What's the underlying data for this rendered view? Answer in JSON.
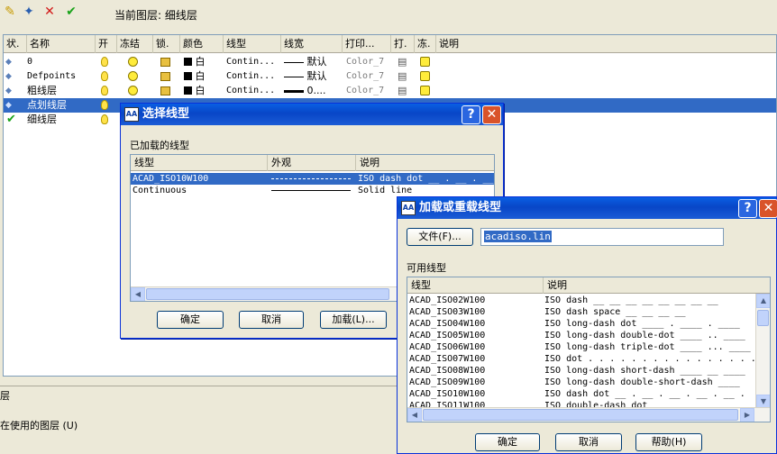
{
  "toolbar": {
    "current_layer_label": "当前图层: 细线层"
  },
  "layer_table": {
    "columns": [
      "状.",
      "名称",
      "开",
      "冻结",
      "锁.",
      "颜色",
      "线型",
      "线宽",
      "打印...",
      "打.",
      "冻.",
      "说明"
    ],
    "rows": [
      {
        "name": "0",
        "color": "白",
        "linetype": "Contin...",
        "lineweight": "默认",
        "plot_style": "Color_7",
        "current": false,
        "selected": false
      },
      {
        "name": "Defpoints",
        "color": "白",
        "linetype": "Contin...",
        "lineweight": "默认",
        "plot_style": "Color_7",
        "current": false,
        "selected": false
      },
      {
        "name": "粗线层",
        "color": "白",
        "linetype": "Contin...",
        "lineweight": "0....",
        "plot_style": "Color_7",
        "current": false,
        "selected": false
      },
      {
        "name": "点划线层",
        "color": "",
        "linetype": "",
        "lineweight": "",
        "plot_style": "",
        "current": false,
        "selected": true
      },
      {
        "name": "细线层",
        "color": "",
        "linetype": "",
        "lineweight": "",
        "plot_style": "",
        "current": true,
        "selected": false
      }
    ]
  },
  "bottom": {
    "fragment1": "层",
    "fragment2": "在使用的图层 (U)"
  },
  "select_dialog": {
    "title": "选择线型",
    "loaded_label": "已加载的线型",
    "columns": [
      "线型",
      "外观",
      "说明"
    ],
    "rows": [
      {
        "name": "ACAD_ISO10W100",
        "desc": "ISO dash dot __ . __ . __",
        "selected": true
      },
      {
        "name": "Continuous",
        "desc": "Solid line",
        "selected": false
      }
    ],
    "ok": "确定",
    "cancel": "取消",
    "load": "加载(L)..."
  },
  "load_dialog": {
    "title": "加载或重载线型",
    "file_button": "文件(F)...",
    "file_value": "acadiso.lin",
    "available_label": "可用线型",
    "columns": [
      "线型",
      "说明"
    ],
    "rows": [
      {
        "name": "ACAD_ISO02W100",
        "desc": "ISO dash __ __ __ __ __ __ __ __"
      },
      {
        "name": "ACAD_ISO03W100",
        "desc": "ISO dash space __    __    __    __"
      },
      {
        "name": "ACAD_ISO04W100",
        "desc": "ISO long-dash dot ____ . ____ . ____"
      },
      {
        "name": "ACAD_ISO05W100",
        "desc": "ISO long-dash double-dot ____ .. ____"
      },
      {
        "name": "ACAD_ISO06W100",
        "desc": "ISO long-dash triple-dot ____ ... ____"
      },
      {
        "name": "ACAD_ISO07W100",
        "desc": "ISO dot . . . . . . . . . . . . . . . ."
      },
      {
        "name": "ACAD_ISO08W100",
        "desc": "ISO long-dash short-dash ____ __ ____"
      },
      {
        "name": "ACAD_ISO09W100",
        "desc": "ISO long-dash double-short-dash ____"
      },
      {
        "name": "ACAD_ISO10W100",
        "desc": "ISO dash dot __ . __ . __ . __ . __ ."
      },
      {
        "name": "ACAD_ISO11W100",
        "desc": "ISO double-dash dot"
      }
    ],
    "ok": "确定",
    "cancel": "取消",
    "help": "帮助(H)"
  }
}
